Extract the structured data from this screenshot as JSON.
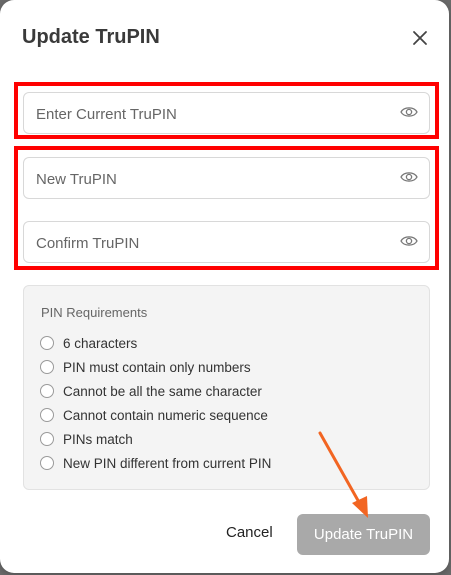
{
  "dialog": {
    "title": "Update TruPIN",
    "close_icon": "close-icon"
  },
  "fields": {
    "current": {
      "placeholder": "Enter Current TruPIN",
      "value": "",
      "icon": "eye-icon"
    },
    "new": {
      "placeholder": "New TruPIN",
      "value": "",
      "icon": "eye-icon"
    },
    "confirm": {
      "placeholder": "Confirm TruPIN",
      "value": "",
      "icon": "eye-icon"
    }
  },
  "requirements": {
    "title": "PIN Requirements",
    "items": [
      "6 characters",
      "PIN must contain only numbers",
      "Cannot be all the same character",
      "Cannot contain numeric sequence",
      "PINs match",
      "New PIN different from current PIN"
    ]
  },
  "actions": {
    "cancel_label": "Cancel",
    "update_label": "Update TruPIN"
  },
  "colors": {
    "highlight": "#ff0000",
    "arrow": "#f26522",
    "disabled_button": "#a9a9a9"
  }
}
